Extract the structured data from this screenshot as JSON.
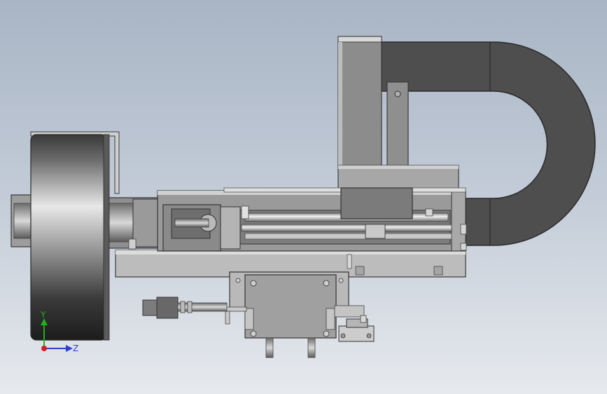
{
  "viewport": {
    "background_top": "#a9b5c5",
    "background_bottom": "#e6e9ed"
  },
  "triad": {
    "y_label": "Y",
    "z_label": "Z",
    "y_color": "#1fb01f",
    "z_color": "#2a3fd6",
    "origin_color": "#d42020"
  },
  "model": {
    "name_icons": [
      "disc-wheel",
      "linear-actuator",
      "cable-chain",
      "connector-plug",
      "bracket"
    ]
  }
}
